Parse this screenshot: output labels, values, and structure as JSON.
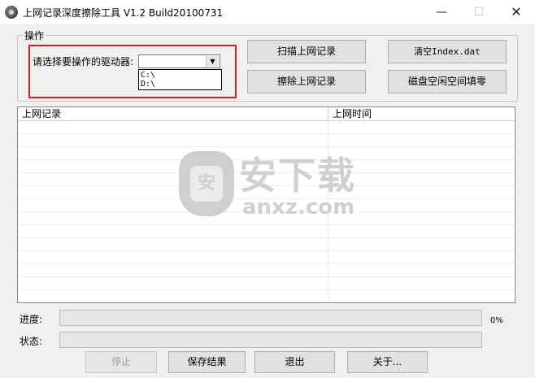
{
  "window": {
    "title": "上网记录深度擦除工具 V1.2   Build20100731",
    "controls": {
      "minimize": "—",
      "maximize": "☐",
      "close": "✕"
    }
  },
  "operations": {
    "group_label": "操作",
    "drive_label": "请选择要操作的驱动器:",
    "drive_selected": "",
    "drive_options": [
      "C:\\",
      "D:\\"
    ],
    "buttons": {
      "scan": "扫描上网记录",
      "erase": "擦除上网记录",
      "clear_index": "清空Index.dat",
      "wipe_free": "磁盘空闲空间填零"
    }
  },
  "records": {
    "columns": [
      "上网记录",
      "上网时间"
    ],
    "rows": []
  },
  "watermark": {
    "cn": "安下载",
    "en": "anxz.com",
    "shield": "安"
  },
  "progress": {
    "label": "进度:",
    "value": 0,
    "percent_text": "0%"
  },
  "status": {
    "label": "状态:",
    "text": ""
  },
  "footer": {
    "stop": "停止",
    "save": "保存结果",
    "exit": "退出",
    "about": "关于..."
  },
  "colors": {
    "highlight": "#d9201f",
    "progress_fill": "#06b025"
  }
}
